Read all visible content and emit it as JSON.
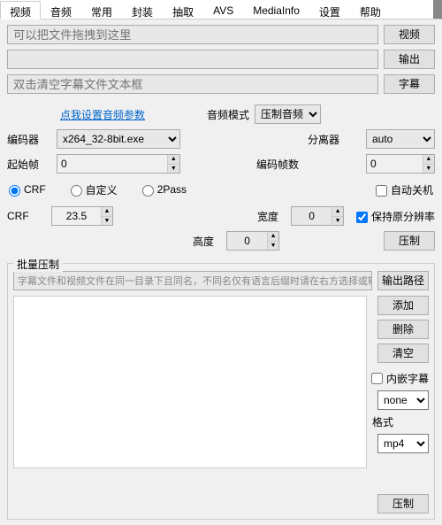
{
  "tabs": [
    "视频",
    "音频",
    "常用",
    "封装",
    "抽取",
    "AVS",
    "MediaInfo",
    "设置",
    "帮助"
  ],
  "activeTab": 0,
  "top": {
    "dragPlaceholder": "可以把文件拖拽到这里",
    "videoBtn": "视频",
    "outputBtn": "输出",
    "subtitlePlaceholder": "双击清空字幕文件文本框",
    "subtitleBtn": "字幕"
  },
  "audio": {
    "linkText": "点我设置音频参数",
    "modeLabel": "音频模式",
    "modeValue": "压制音频"
  },
  "encoder": {
    "label": "编码器",
    "value": "x264_32-8bit.exe",
    "demuxLabel": "分离器",
    "demuxValue": "auto"
  },
  "frames": {
    "startLabel": "起始帧",
    "startValue": "0",
    "countLabel": "编码帧数",
    "countValue": "0"
  },
  "modes": {
    "crf": "CRF",
    "custom": "自定义",
    "twopass": "2Pass",
    "autoShutdown": "自动关机"
  },
  "params": {
    "crfLabel": "CRF",
    "crfValue": "23.5",
    "widthLabel": "宽度",
    "widthValue": "0",
    "heightLabel": "高度",
    "heightValue": "0",
    "keepRes": "保持原分辨率",
    "encodeBtn": "压制"
  },
  "batch": {
    "legend": "批量压制",
    "inputPlaceholder": "字幕文件和视频文件在同一目录下且同名，不同名仅有语言后缀时请在右方选择或输入",
    "outPathBtn": "输出路径",
    "addBtn": "添加",
    "delBtn": "删除",
    "clearBtn": "清空",
    "embedSub": "内嵌字幕",
    "subValue": "none",
    "formatLabel": "格式",
    "formatValue": "mp4",
    "encodeBtn": "压制"
  }
}
